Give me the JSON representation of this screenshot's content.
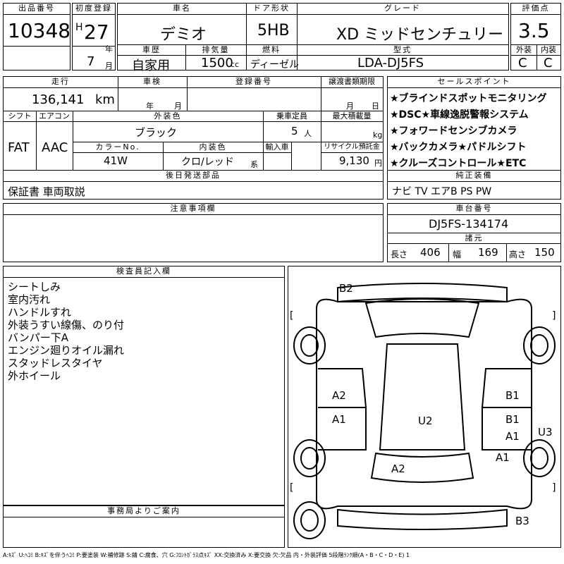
{
  "header": {
    "lot_number_label": "出品番号",
    "lot_number": "10348",
    "first_reg_label": "初度登録",
    "era_mark": "H",
    "year": "27",
    "year_unit": "年",
    "month": "7",
    "month_unit": "月",
    "car_name_label": "車名",
    "car_name": "デミオ",
    "door_label": "ドア形状",
    "door": "5HB",
    "grade_label": "グレード",
    "grade": "XD ミッドセンチュリー",
    "score_label": "評価点",
    "score": "3.5",
    "history_label": "車歴",
    "history": "自家用",
    "displacement_label": "排気量",
    "displacement": "1500",
    "displacement_unit": "cc",
    "fuel_label": "燃料",
    "fuel": "ディーゼル",
    "model_code_label": "型式",
    "model_code": "LDA-DJ5FS",
    "exterior_label": "外装",
    "exterior_grade": "C",
    "interior_label": "内装",
    "interior_grade": "C"
  },
  "details": {
    "mileage_label": "走行",
    "mileage": "136,141",
    "mileage_unit": "km",
    "inspection_label": "車検",
    "inspection_year_unit": "年",
    "inspection_month_unit": "月",
    "plate_label": "登録番号",
    "transfer_label": "譲渡書類期限",
    "transfer_month_unit": "月",
    "transfer_day_unit": "日",
    "shift_label": "シフト",
    "shift": "FAT",
    "ac_label": "エアコン",
    "ac": "AAC",
    "color_label": "外装色",
    "color": "ブラック",
    "capacity_label": "乗車定員",
    "capacity": "5",
    "capacity_unit": "人",
    "max_load_label": "最大積載量",
    "max_load_unit": "kg",
    "color_no_label": "カラーNo.",
    "color_no": "41W",
    "interior_color_label": "内装色",
    "interior_color": "クロ/レッド",
    "interior_color_unit": "系",
    "import_label": "輸入車",
    "recycle_label": "リサイクル預託金",
    "recycle": "9,130",
    "recycle_unit": "円",
    "later_parts_label": "後日発送部品",
    "later_parts": "保証書 車両取説",
    "notes_label": "注意事項欄"
  },
  "sales_points": {
    "label": "セールスポイント",
    "items": [
      "★ブラインドスポットモニタリング",
      "★DSC★車線逸脱警報システム",
      "★フォワードセンシブカメラ",
      "★バックカメラ★パドルシフト",
      "★クルーズコントロール★ETC"
    ]
  },
  "equipment": {
    "label": "純正装備",
    "value": "ナビ TV エアB PS PW"
  },
  "chassis": {
    "label": "車台番号",
    "value": "DJ5FS-134174"
  },
  "dimensions": {
    "label": "諸元",
    "length_label": "長さ",
    "length": "406",
    "width_label": "幅",
    "width": "169",
    "height_label": "高さ",
    "height": "150"
  },
  "inspector": {
    "label": "検査員記入欄",
    "lines": [
      "シートしみ",
      "室内汚れ",
      "ハンドルすれ",
      "外装うすい線傷、のり付",
      "バンパー下A",
      "エンジン廻りオイル漏れ",
      "スタッドレスタイヤ",
      "外ホイール"
    ]
  },
  "office": {
    "label": "事務局よりご案内"
  },
  "diagram_marks": {
    "b2": "B2",
    "a2_left": "A2",
    "a1_left": "A1",
    "b1_right_top": "B1",
    "b1_right_mid": "B1",
    "a1_right_mid": "A1",
    "u3": "U3",
    "u2": "U2",
    "a1_right_low": "A1",
    "a2_center": "A2",
    "b3": "B3",
    "bracket_open": "[",
    "bracket_close": "]"
  },
  "legend": "A:ｷｽﾞ U:ﾍｺﾐ B:ｷｽﾞを伴うﾍｺﾐ P:要塗装 W:補修跡 S:錆 C:腐食、穴 G:ﾌﾛﾝﾄｶﾞﾗｽ点ｷｽﾞ XX:交換済み X:要交換 欠:欠品 内・外装評価 5段階ﾗﾝｸ順(A・B・C・D・E) 1"
}
